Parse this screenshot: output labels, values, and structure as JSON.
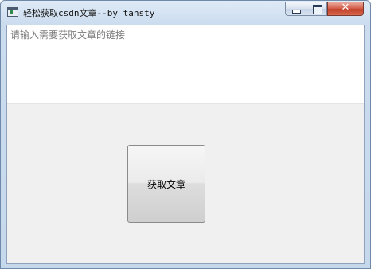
{
  "window": {
    "title": "轻松获取csdn文章--by tansty",
    "controls": {
      "minimize_icon": "minimize-icon",
      "maximize_icon": "maximize-icon",
      "close_icon": "close-icon",
      "close_glyph": "✕"
    }
  },
  "form": {
    "link_input": {
      "placeholder": "请输入需要获取文章的链接",
      "value": ""
    },
    "fetch_button_label": "获取文章"
  },
  "colors": {
    "close_button": "#c2402a",
    "client_background": "#f0f0f0",
    "titlebar": "#cbdcef"
  }
}
